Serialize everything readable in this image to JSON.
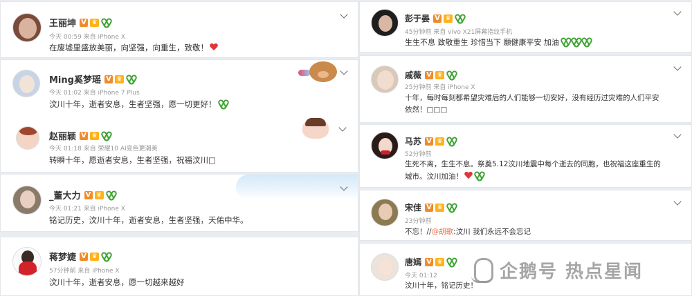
{
  "left_posts": [
    {
      "name": "王丽坤",
      "meta": "今天 00:59 来自 iPhone X",
      "text": "在废墟里盛放美丽，向坚强，向重生，致敬！",
      "has_heart": true
    },
    {
      "name": "Ming奚梦瑶",
      "meta": "今天 01:02 来自 iPhone 7 Plus",
      "text": "汶川十年，逝者安息，生者坚强，愿一切更好！",
      "has_ribbon": true
    },
    {
      "name": "赵丽颖",
      "meta": "今天 01:18 来自 荣耀10 AI变色更潮美",
      "text": "转瞬十年，愿逝者安息，生者坚强，祝福汶川□"
    },
    {
      "name": "_董大力",
      "meta": "今天 01:21 来自 iPhone X",
      "text": "铭记历史，汶川十年，逝者安息，生者坚强，天佑中华。"
    },
    {
      "name": "蒋梦婕",
      "meta": "57分钟前 来自 iPhone X",
      "text": "汶川十年，逝者安息，愿一切越来越好"
    }
  ],
  "right_posts": [
    {
      "name": "彭于晏",
      "meta": "45分钟前 来自 vivo X21屏幕指纹手机",
      "text": "生生不息 致敬重生 珍惜当下 願健康平安 加油",
      "ribbons": 3
    },
    {
      "name": "戚薇",
      "meta": "25分钟前 来自 iPhone X",
      "text_line1": "十年，每时每刻都希望灾难后的人们能够一切安好，没有经历过灾难的人们平安",
      "text_line2": "依然！□□□"
    },
    {
      "name": "马苏",
      "meta": "52分钟前",
      "text_line1": "生死不离，生生不息。祭奠5.12汶川地震中每个逝去的同胞，也祝福这座重生的",
      "text_line2": "城市。汶川加油！"
    },
    {
      "name": "宋佳",
      "meta": "23分钟前",
      "text_prefix": "不忘！//",
      "mention": "@胡歌",
      "text_suffix": ":汶川 我们永远不会忘记"
    },
    {
      "name": "唐嫣",
      "meta": "今天 01:12",
      "text": "汶川十年，铭记历史！"
    }
  ],
  "watermark": {
    "text": "企鹅号 热点星闻"
  },
  "colors": {
    "badge_v": "#f08b2b",
    "badge_vip": "#ffb21a",
    "ribbon": "#3fa334",
    "heart": "#e0353b",
    "mention": "#eb7350"
  },
  "icons": [
    "verified-v-icon",
    "vip-crown-icon",
    "green-ribbon-icon",
    "chevron-down-icon",
    "heart-icon"
  ]
}
